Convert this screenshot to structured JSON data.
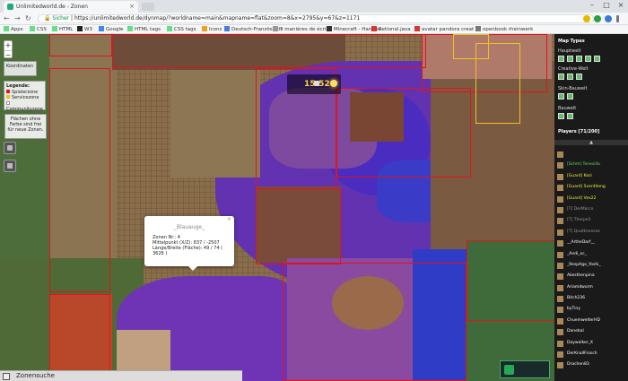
{
  "browser": {
    "tab_title": "Unlimitedworld.de - Zonen",
    "url_secure_label": "Sicher",
    "url": "https://unlimitedworld.de/dynmap/?worldname=main&mapname=flat&zoom=8&x=2795&y=67&z=1171",
    "bookmarks": [
      "Apps",
      "CSS",
      "HTML",
      "W3",
      "Google",
      "HTML tags",
      "CSS tags",
      "Icons",
      "Deutsch-Französisch",
      "3 manières de écrire",
      "Minecraft - Handbu",
      "Retional.java",
      "avatar pandora creat",
      "openbook rheinwerk"
    ]
  },
  "map": {
    "clock": "15:52",
    "zoom_in": "+",
    "zoom_out": "−",
    "coords_title": "Koordinaten",
    "legend_title": "Legende:",
    "legend_items": [
      {
        "label": "Spielerzone",
        "color": "#e0141e"
      },
      {
        "label": "Servicezone",
        "color": "#f0c020"
      },
      {
        "label": "Communityzone",
        "color": "#ffffff"
      }
    ],
    "note_text": "Flächen ohne Farbe sind frei für neue Zonen.",
    "popup": {
      "name": "_Blauauge_",
      "close": "×",
      "line1": "Zonen Nr.: 4",
      "line2": "Mittelpunkt (X/Z): 837 / -2507",
      "line3": "Länge/Breite (Fläche): 49 / 74 ( 3626 )"
    },
    "search_label": "Zonensuche"
  },
  "sidebar": {
    "map_types": "Map Types",
    "hauptwelt": "Hauptwelt",
    "creative": "Creative-Welt",
    "skin": "Skin-Bauwelt",
    "bauwelt": "Bauwelt",
    "players_header": "Players [71/200]",
    "scroll_up": "▲",
    "players": [
      {
        "name": "",
        "cls": "orn"
      },
      {
        "name": "[Schm] Tenesilla",
        "cls": "grn"
      },
      {
        "name": "[Guard] Kezi",
        "cls": "yel"
      },
      {
        "name": "[Guard] Svenfdeng",
        "cls": "yel"
      },
      {
        "name": "[Guard] Vex22",
        "cls": "yel"
      },
      {
        "name": "[T] DerMarco",
        "cls": "dim"
      },
      {
        "name": "[T] Thorpe3",
        "cls": "dim"
      },
      {
        "name": "[T] Quattrorosse",
        "cls": "dim"
      },
      {
        "name": "__ArtheDarf__",
        "cls": ""
      },
      {
        "name": "_Andi_xc_",
        "cls": ""
      },
      {
        "name": "_RespAgo_Yoshi_",
        "cls": ""
      },
      {
        "name": "Akesthenpina",
        "cls": ""
      },
      {
        "name": "Ariamdworm",
        "cls": ""
      },
      {
        "name": "Bitch236",
        "cls": ""
      },
      {
        "name": "byTiny",
        "cls": ""
      },
      {
        "name": "ChuemwelterHD",
        "cls": ""
      },
      {
        "name": "Danebal",
        "cls": ""
      },
      {
        "name": "Daywalker_X",
        "cls": ""
      },
      {
        "name": "DerKnallFrosch",
        "cls": ""
      },
      {
        "name": "Drachen83",
        "cls": ""
      }
    ]
  }
}
